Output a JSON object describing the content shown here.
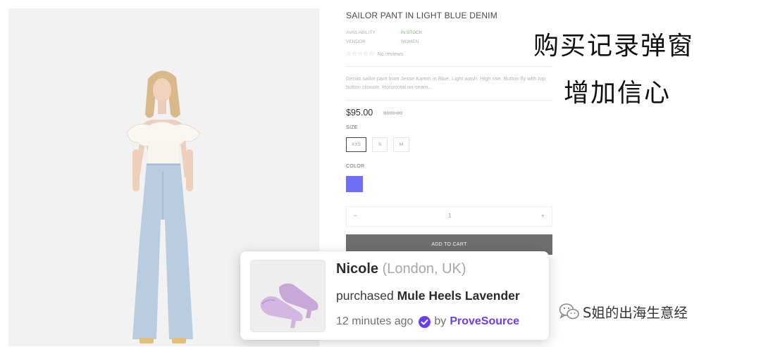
{
  "product": {
    "title": "SAILOR PANT IN LIGHT BLUE DENIM",
    "availability_label": "AVAILABILITY",
    "availability_value": ": IN STOCK",
    "vendor_label": "VENDOR",
    "vendor_value": ": WOMEN",
    "rating_stars": "☆☆☆☆☆",
    "reviews_text": "No reviews",
    "description": "Denim sailor pant from Jesse Kamm in Blue. Light wash. High rise. Button fly with top button closure. Horizontal on-seam...",
    "price": "$95.00",
    "old_price": "$100.00",
    "size_label": "SIZE",
    "sizes": [
      "XXS",
      "S",
      "M"
    ],
    "selected_size": "XXS",
    "color_label": "COLOR",
    "color_swatch": "#6f6ff5",
    "qty_minus": "−",
    "qty_value": "1",
    "qty_plus": "+",
    "add_to_cart": "ADD TO CART"
  },
  "annotation": {
    "line1": "购买记录弹窗",
    "line2": "增加信心"
  },
  "popup": {
    "name": "Nicole",
    "location": "(London, UK)",
    "action": "purchased",
    "product": "Mule Heels Lavender",
    "time": "12 minutes ago",
    "by": "by",
    "brand": "ProveSource",
    "verified_icon": "check-circle-icon",
    "brand_color": "#6a3df0"
  },
  "watermark": {
    "text": "S姐的出海生意经",
    "icon": "wechat-icon"
  }
}
